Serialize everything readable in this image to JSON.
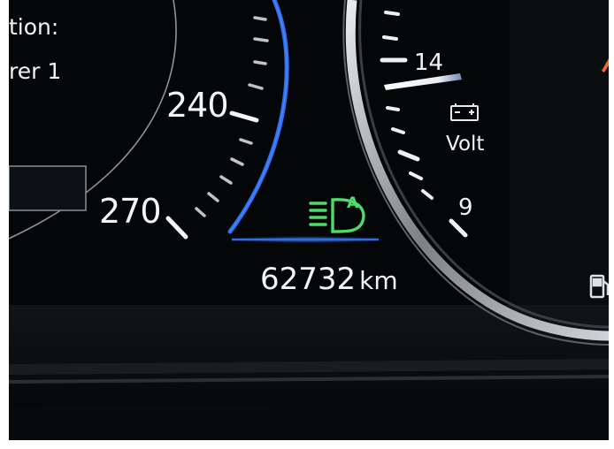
{
  "info_display": {
    "line1": "tion:",
    "line2": "rer 1"
  },
  "speedometer": {
    "labels": [
      "240",
      "270"
    ],
    "accent_color": "#2f6ff0"
  },
  "voltmeter": {
    "labels": [
      "14",
      "9"
    ],
    "unit": "Volt",
    "indicated_volts": 14,
    "icon": "battery-icon"
  },
  "headlight_indicator": {
    "icon": "auto-high-beam-icon",
    "letter": "A",
    "color": "#4ddc6a"
  },
  "odometer": {
    "value": "62732",
    "unit": "km"
  },
  "side_icon": "fuel-pump-icon"
}
